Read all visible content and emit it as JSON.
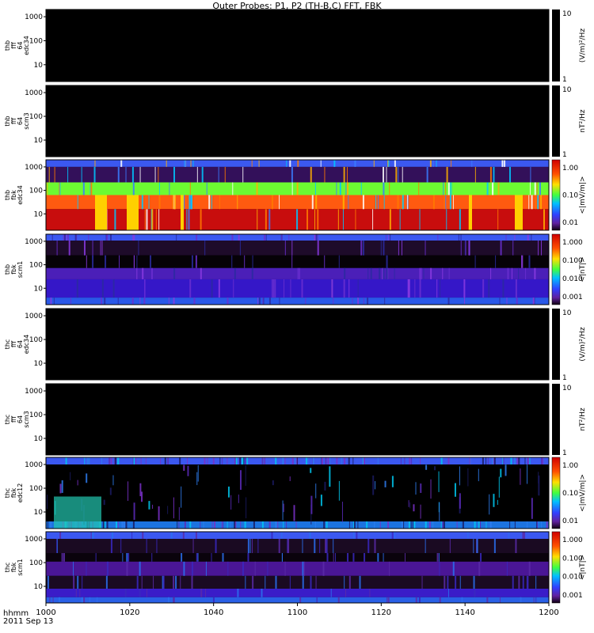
{
  "title": "Outer Probes: P1, P2 (TH-B,C) FFT, FBK",
  "x_ticks": [
    "1000",
    "1020",
    "1040",
    "1100",
    "1120",
    "1140",
    "1200"
  ],
  "x_label_line1": "hhmm",
  "x_label_line2": "2011 Sep 13",
  "panels": [
    {
      "ylabel": [
        "thb",
        "fff",
        "64",
        "edc34"
      ],
      "cbar_label": "(V/m)²/Hz",
      "cbar_ticks": [
        "10",
        "1"
      ],
      "cbar_type": "black",
      "y_ticks": [
        "1000",
        "100",
        "10"
      ]
    },
    {
      "ylabel": [
        "thb",
        "fff",
        "64",
        "scm3"
      ],
      "cbar_label": "nT²/Hz",
      "cbar_ticks": [
        "10",
        "1"
      ],
      "cbar_type": "black",
      "y_ticks": [
        "1000",
        "100",
        "10"
      ]
    },
    {
      "ylabel": [
        "thb",
        "fbk",
        "edc34"
      ],
      "cbar_label": "<|mV/m|>",
      "cbar_ticks": [
        "1.00",
        "0.10",
        "0.01"
      ],
      "cbar_type": "color",
      "y_ticks": [
        "1000",
        "100",
        "10"
      ]
    },
    {
      "ylabel": [
        "thb",
        "fbk",
        "scm1"
      ],
      "cbar_label": "<|nT|>",
      "cbar_ticks": [
        "1.000",
        "0.100",
        "0.010",
        "0.001"
      ],
      "cbar_type": "color",
      "y_ticks": [
        "1000",
        "100",
        "10"
      ]
    },
    {
      "ylabel": [
        "thc",
        "fff",
        "64",
        "edc34"
      ],
      "cbar_label": "(V/m)²/Hz",
      "cbar_ticks": [
        "10",
        "1"
      ],
      "cbar_type": "black",
      "y_ticks": [
        "1000",
        "100",
        "10"
      ]
    },
    {
      "ylabel": [
        "thc",
        "fff",
        "64",
        "scm3"
      ],
      "cbar_label": "nT²/Hz",
      "cbar_ticks": [
        "10",
        "1"
      ],
      "cbar_type": "black",
      "y_ticks": [
        "1000",
        "100",
        "10"
      ]
    },
    {
      "ylabel": [
        "thc",
        "fbk",
        "edc12"
      ],
      "cbar_label": "<|mV/m|>",
      "cbar_ticks": [
        "1.00",
        "0.10",
        "0.01"
      ],
      "cbar_type": "color",
      "y_ticks": [
        "1000",
        "100",
        "10"
      ]
    },
    {
      "ylabel": [
        "thc",
        "fbk",
        "scm1"
      ],
      "cbar_label": "<|nT|>",
      "cbar_ticks": [
        "1.000",
        "0.100",
        "0.010",
        "0.001"
      ],
      "cbar_type": "color",
      "y_ticks": [
        "1000",
        "100",
        "10"
      ]
    }
  ],
  "chart_data": {
    "type": "heatmap",
    "title": "Outer Probes: P1, P2 (TH-B,C) FFT, FBK",
    "x_range": [
      "1000",
      "1200"
    ],
    "y_scale": "log",
    "y_range": [
      2,
      2000
    ],
    "panels": [
      {
        "name": "thb fff 64 edc34",
        "state": "no data (all black)"
      },
      {
        "name": "thb fff 64 scm3",
        "state": "no data (all black)"
      },
      {
        "name": "thb fbk edc34",
        "bands": [
          "blue",
          "purple",
          "green",
          "orange",
          "red"
        ]
      },
      {
        "name": "thb fbk scm1",
        "bands": [
          "blue",
          "dark purple",
          "dark",
          "purple",
          "dark blue",
          "blue/cyan"
        ]
      },
      {
        "name": "thc fff 64 edc34",
        "state": "no data (all black)"
      },
      {
        "name": "thc fff 64 scm3",
        "state": "no data (all black)"
      },
      {
        "name": "thc fbk edc12",
        "bands": [
          "blue",
          "black with purple/blue streaks",
          "cyan/green"
        ]
      },
      {
        "name": "thc fbk scm1",
        "bands": [
          "blue",
          "dark",
          "purple",
          "dark",
          "blue",
          "cyan"
        ]
      }
    ]
  }
}
